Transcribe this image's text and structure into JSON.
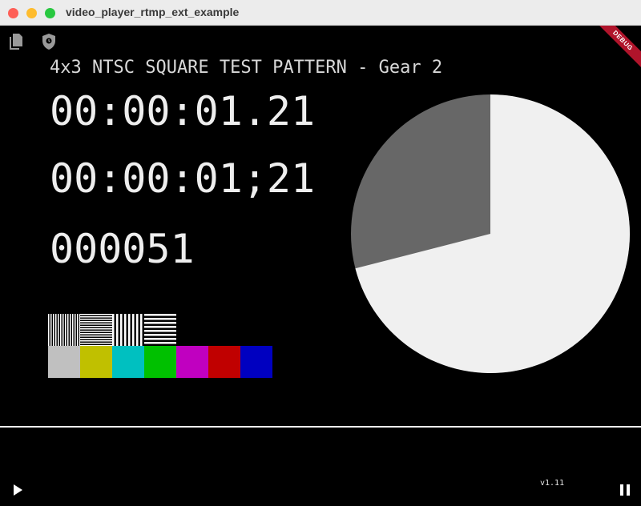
{
  "window": {
    "title": "video_player_rtmp_ext_example"
  },
  "toolbar": {
    "icons": [
      "copy-icon",
      "shield-icon"
    ]
  },
  "debug_banner": {
    "label": "DEBUG",
    "color": "#b0142b"
  },
  "video": {
    "pattern_title": "4x3 NTSC SQUARE TEST PATTERN - Gear 2",
    "timecode_dot": "00:00:01.21",
    "timecode_semicolon": "00:00:01;21",
    "frame_count": "000051",
    "pie_progress": 0.71,
    "pie_colors": {
      "filled": "#f0f0f0",
      "remaining": "#676767"
    },
    "color_bars": [
      "#c0c0c0",
      "#c0c000",
      "#00c0c0",
      "#00c000",
      "#c000c0",
      "#c00000",
      "#0000c0"
    ]
  },
  "controls": {
    "play_icon": "play-icon",
    "pause_icon": "pause-icon",
    "version": "v1.11"
  }
}
